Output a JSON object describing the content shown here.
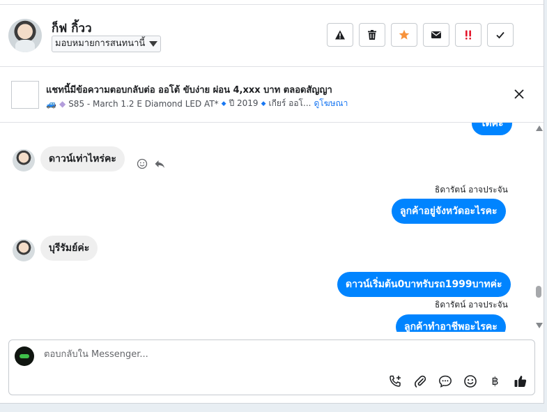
{
  "header": {
    "contact_name": "ก็ฟ กิ้วว",
    "assign_label": "มอบหมายการสนทนานี้",
    "actions": [
      {
        "name": "warning-icon"
      },
      {
        "name": "trash-icon"
      },
      {
        "name": "star-icon",
        "color": "#f7923b"
      },
      {
        "name": "envelope-icon"
      },
      {
        "name": "double-exclamation-icon",
        "color": "#e4162b"
      },
      {
        "name": "check-icon"
      }
    ]
  },
  "ad": {
    "title": "แชทนี้มีข้อความตอบกลับต่อ ออโต้ ขับง่าย ผ่อน 4,xxx บาท ตลอดสัญญา",
    "model": "S85 - March 1.2 E Diamond LED AT*",
    "year": "ปี 2019",
    "gear": "เกียร์ ออโ...",
    "view_ad": "ดูโฆษณา"
  },
  "messages": {
    "partial_top": "โตคะ",
    "msg1": "ดาวน์เท่าไหร่คะ",
    "sender1": "ธิดารัตน์ อาจประจัน",
    "msg2": "ลูกค้าอยู่จังหวัดอะไรคะ",
    "msg3": "บุรีรัมย์ค่ะ",
    "msg4": "ดาวน์เริ่มต้น0บาทรับรถ1999บาทค่ะ",
    "sender2": "ธิดารัตน์ อาจประจัน",
    "msg5": "ลูกค้าทำอาชีพอะไรคะ"
  },
  "composer": {
    "placeholder": "ตอบกลับใน Messenger...",
    "tools": [
      "phone-add-icon",
      "paperclip-icon",
      "chat-bubble-icon",
      "emoji-icon",
      "baht-icon",
      "thumbs-up-icon"
    ],
    "baht_symbol": "฿"
  },
  "colors": {
    "accent": "#0084ff",
    "incoming_bubble": "#efefef"
  }
}
